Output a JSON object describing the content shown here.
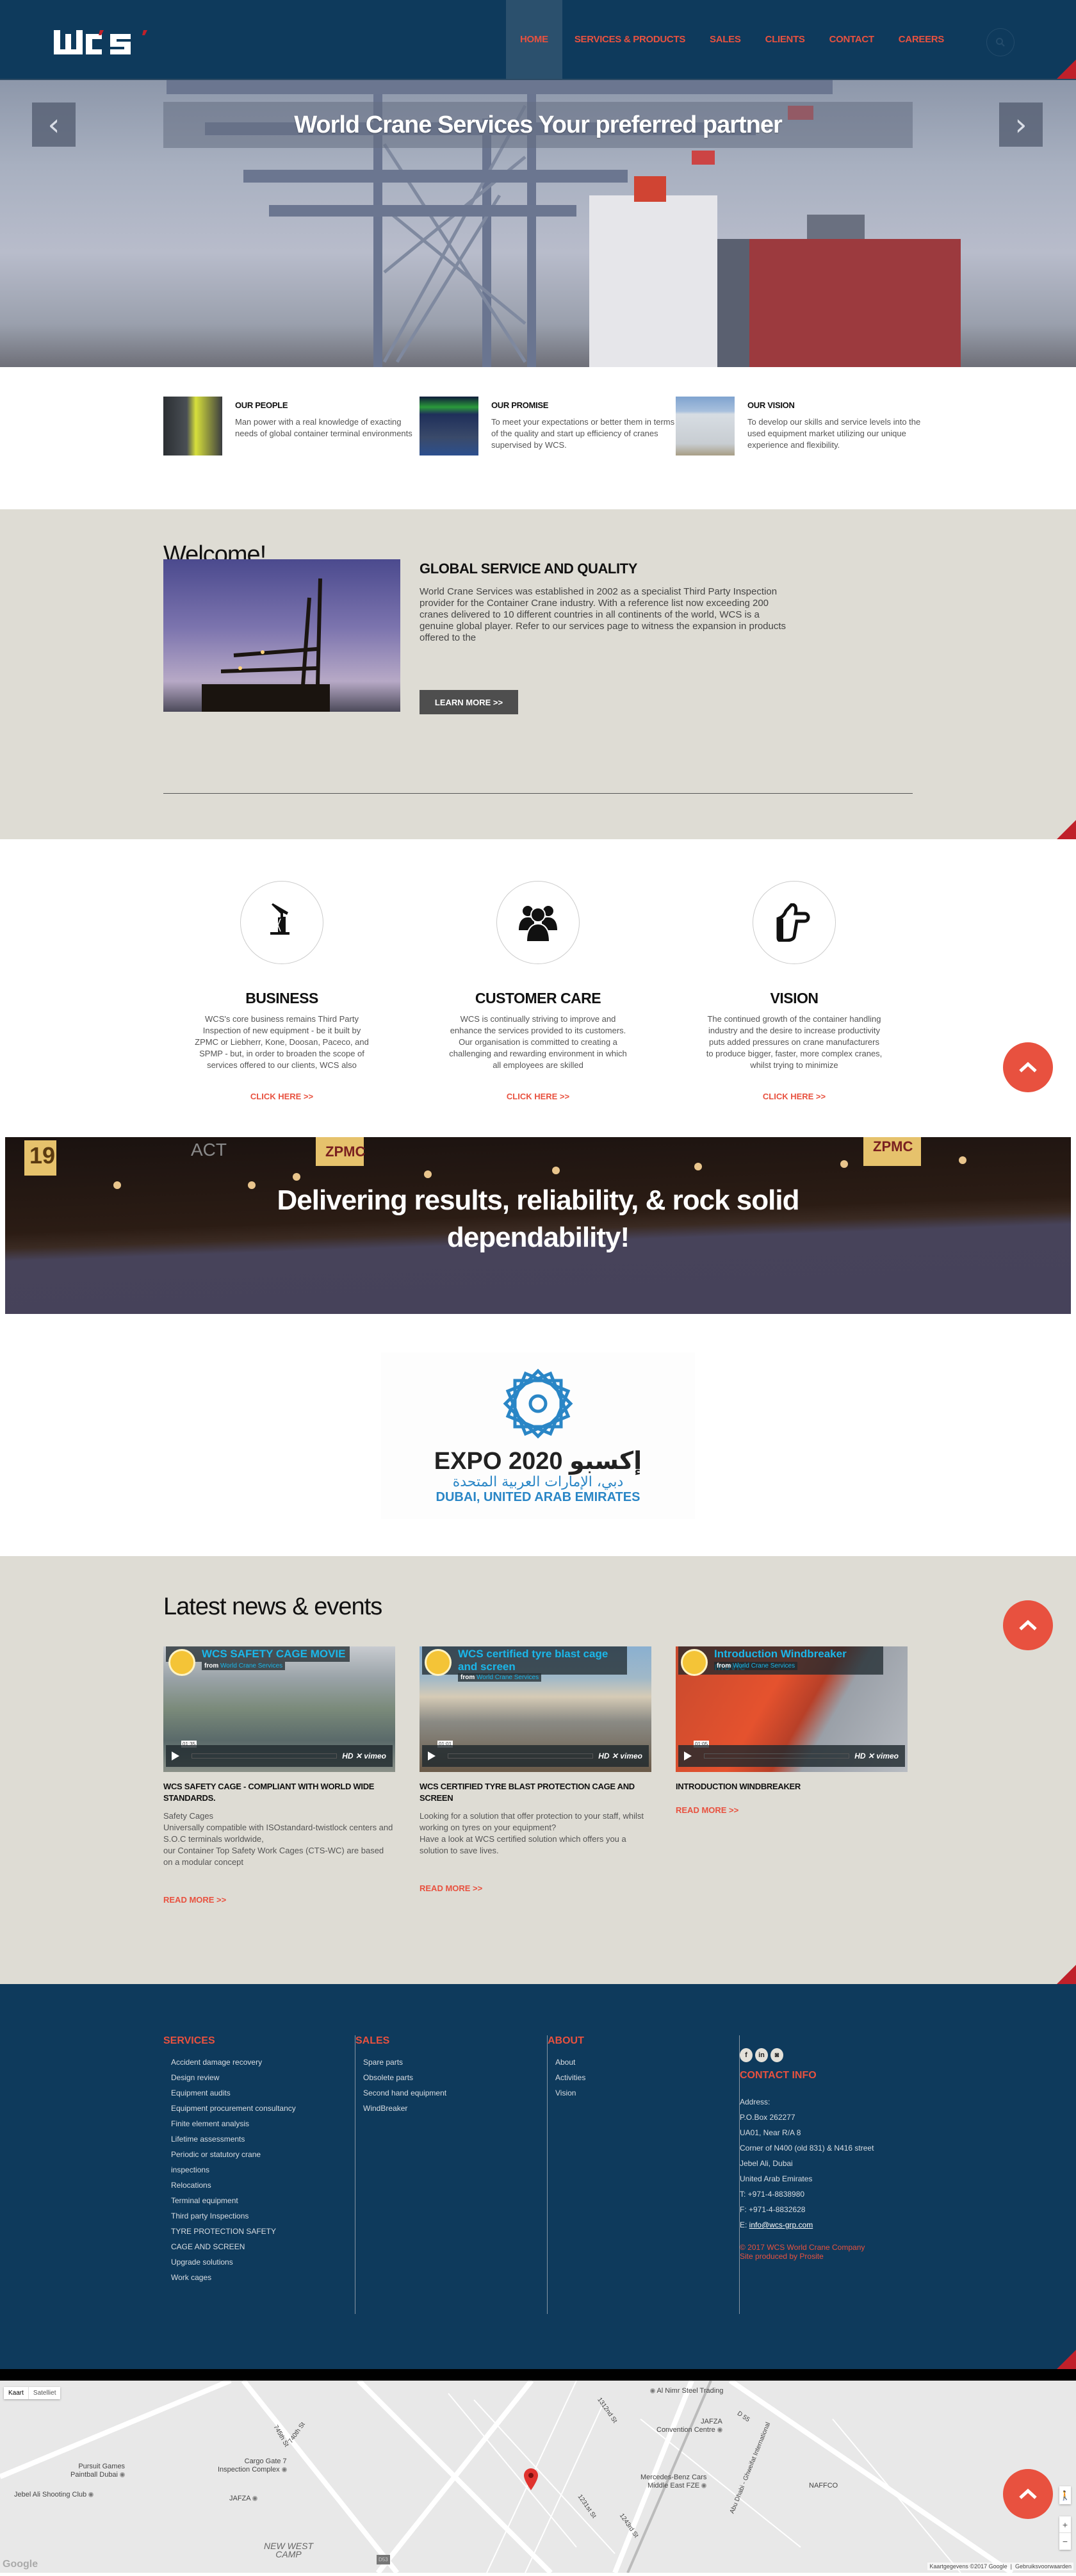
{
  "colors": {
    "navy": "#0e3a5c",
    "accent": "#e8513f",
    "corner_red": "#c0202a",
    "beige": "#dedcd4",
    "vimeo_blue": "#1ab7ea"
  },
  "header": {
    "logo_text": "WCS",
    "nav": [
      {
        "label": "HOME",
        "active": true
      },
      {
        "label": "SERVICES & PRODUCTS",
        "active": false
      },
      {
        "label": "SALES",
        "active": false
      },
      {
        "label": "CLIENTS",
        "active": false
      },
      {
        "label": "CONTACT",
        "active": false
      },
      {
        "label": "CAREERS",
        "active": false
      }
    ],
    "search_icon": "search-icon"
  },
  "hero": {
    "caption": "World Crane Services Your preferred partner",
    "prev_icon": "‹",
    "next_icon": "›"
  },
  "features": [
    {
      "title": "OUR PEOPLE",
      "text": "Man power with a real knowledge of exacting needs of global container terminal environments"
    },
    {
      "title": "OUR PROMISE",
      "text": "To meet your expectations or better them in terms of the quality and start up efficiency of cranes supervised by WCS."
    },
    {
      "title": "OUR VISION",
      "text": "To develop our skills and service levels into the used equipment market utilizing our unique experience and flexibility."
    }
  ],
  "welcome": {
    "heading": "Welcome!",
    "subheading": "GLOBAL SERVICE AND QUALITY",
    "body": "World Crane Services was established in 2002 as a specialist Third Party Inspection provider for the Container Crane industry. With a reference list now exceeding 200 cranes delivered to 10 different countries in all continents of the world, WCS is a genuine global player. Refer to our services page to witness the expansion in products offered to the",
    "button": "LEARN MORE >>"
  },
  "pillars": [
    {
      "icon": "oil-pump-icon",
      "title": "BUSINESS",
      "text": "WCS's core business remains Third Party Inspection of new equipment - be it built by ZPMC or Liebherr, Kone, Doosan, Paceco, and SPMP - but, in order to broaden the scope of services offered to our clients, WCS also",
      "link": "CLICK HERE >>"
    },
    {
      "icon": "group-icon",
      "title": "CUSTOMER CARE",
      "text": "WCS is continually striving to improve and enhance the services provided to its customers. Our organisation is committed to creating a challenging and rewarding environment in which all employees are skilled",
      "link": "CLICK HERE >>"
    },
    {
      "icon": "thumbs-up-icon",
      "title": "VISION",
      "text": "The continued growth of the container handling industry and the desire to increase productivity puts added pressures on crane manufacturers to produce bigger, faster, more complex cranes, whilst trying to minimize",
      "link": "CLICK HERE >>"
    }
  ],
  "banner": {
    "line1": "Delivering results, reliability, & rock solid",
    "line2": "dependability!",
    "signs": [
      "19",
      "ACT",
      "ZPMC",
      "ZPMC"
    ]
  },
  "expo": {
    "title": "EXPO 2020",
    "arabic_title": "إكسبو",
    "arabic_sub": "دبي، الإمارات العربية المتحدة",
    "location": "DUBAI, UNITED ARAB EMIRATES"
  },
  "news": {
    "heading": "Latest news & events",
    "items": [
      {
        "video_title": "WCS SAFETY CAGE MOVIE",
        "from_label": "from",
        "from": "World Crane Services",
        "duration": "01:35",
        "title": "WCS SAFETY CAGE - COMPLIANT WITH WORLD WIDE STANDARDS.",
        "text": "Safety Cages\nUniversally compatible with ISOstandard-twistlock centers and S.O.C terminals worldwide,\nour Container Top Safety Work Cages (CTS-WC) are based on a modular concept",
        "link": "READ MORE >>"
      },
      {
        "video_title": "WCS certified tyre blast cage and screen",
        "from_label": "from",
        "from": "World Crane Services",
        "duration": "01:01",
        "title": "WCS CERTIFIED TYRE BLAST PROTECTION CAGE AND SCREEN",
        "text": "Looking for a solution that offer protection to your staff, whilst working on tyres on your equipment?\nHave a look at WCS certified solution which offers you a solution to save lives.",
        "link": "READ MORE >>"
      },
      {
        "video_title": "Introduction Windbreaker movie",
        "from_label": "from",
        "from": "World Crane Services",
        "duration": "01:05",
        "title": "INTRODUCTION WINDBREAKER",
        "text": "",
        "link": "READ MORE >>"
      }
    ],
    "video_brand": "HD ✕ vimeo"
  },
  "footer": {
    "services": {
      "heading": "SERVICES",
      "items": [
        "Accident damage recovery",
        "Design review",
        "Equipment audits",
        "Equipment procurement consultancy",
        "Finite element analysis",
        "Lifetime assessments",
        "Periodic or statutory crane inspections",
        "Relocations",
        "Terminal equipment",
        "Third party Inspections",
        "TYRE PROTECTION SAFETY CAGE AND SCREEN",
        "Upgrade solutions",
        "Work cages"
      ]
    },
    "sales": {
      "heading": "SALES",
      "items": [
        "Spare parts",
        "Obsolete parts",
        "Second hand equipment",
        "WindBreaker"
      ]
    },
    "about": {
      "heading": "ABOUT",
      "items": [
        "About",
        "Activities",
        "Vision"
      ]
    },
    "socials": [
      {
        "icon": "facebook-icon",
        "glyph": "f"
      },
      {
        "icon": "linkedin-icon",
        "glyph": "in"
      },
      {
        "icon": "instagram-icon",
        "glyph": "◙"
      }
    ],
    "contact": {
      "heading": "CONTACT INFO",
      "lines": [
        "Address:",
        "P.O.Box 262277",
        "UA01, Near R/A 8",
        "Corner of N400 (old 831) & N416 street",
        "Jebel Ali, Dubai",
        "United Arab Emirates",
        "T: +971-4-8838980",
        "F: +971-4-8832628"
      ],
      "email_prefix": "E: ",
      "email": "info@wcs-grp.com",
      "copyright": "© 2017 WCS World Crane Company",
      "produced_by": "Site produced by Prosite"
    }
  },
  "map": {
    "type_map": "Kaart",
    "type_satellite": "Satelliet",
    "labels": {
      "pursuit": "Pursuit Games\nPaintball Dubai",
      "shooting": "Jebel Ali Shooting Club",
      "cargo": "Cargo Gate 7\nInspection Complex",
      "jafza": "JAFZA",
      "new_west": "NEW WEST\nCAMP",
      "al_nimr": "Al Nimr Steel Trading",
      "convention": "JAFZA\nConvention Centre",
      "mercedes": "Mercedes-Benz Cars\nMiddle East FZE",
      "naffco": "NAFFCO",
      "st745": "745th St",
      "st740": "740th St",
      "st1312": "1312nd St",
      "st1231": "1231st St",
      "st1243": "1243rd St",
      "d55": "D 55",
      "highway": "Abu Dhabi - Ghweifat International",
      "route": "D53"
    },
    "google": "Google",
    "attribution": "Kaartgegevens ©2017 Google",
    "terms": "Gebruiksvoorwaarden",
    "zoom_in": "+",
    "zoom_out": "−"
  }
}
